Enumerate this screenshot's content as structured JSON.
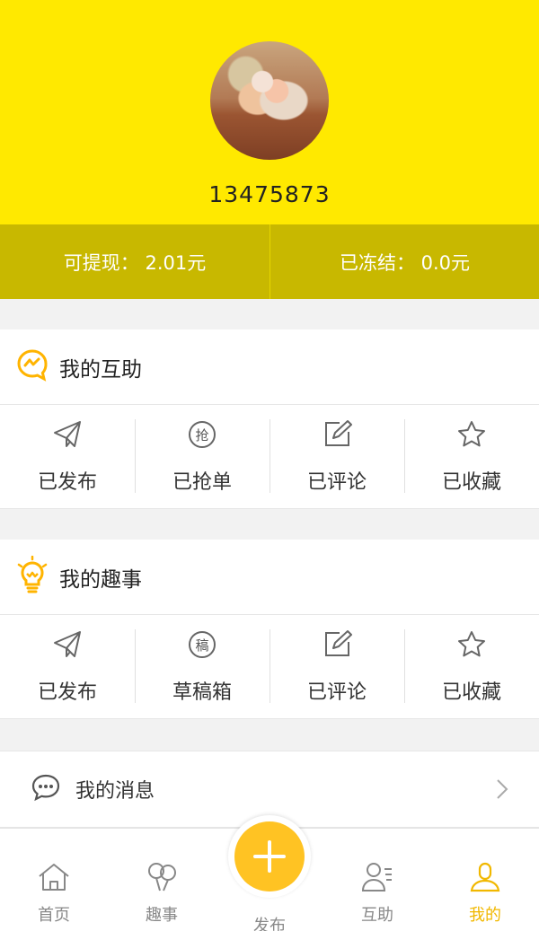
{
  "profile": {
    "phone": "13475873"
  },
  "balance": {
    "withdrawable": "可提现： 2.01元",
    "frozen": "已冻结： 0.0元"
  },
  "help_section": {
    "title": "我的互助",
    "items": [
      {
        "label": "已发布",
        "icon": "paper-plane-icon"
      },
      {
        "label": "已抢单",
        "icon": "grab-order-icon",
        "glyph": "抢"
      },
      {
        "label": "已评论",
        "icon": "edit-icon"
      },
      {
        "label": "已收藏",
        "icon": "star-icon"
      }
    ]
  },
  "fun_section": {
    "title": "我的趣事",
    "items": [
      {
        "label": "已发布",
        "icon": "paper-plane-icon"
      },
      {
        "label": "草稿箱",
        "icon": "draft-icon",
        "glyph": "稿"
      },
      {
        "label": "已评论",
        "icon": "edit-icon"
      },
      {
        "label": "已收藏",
        "icon": "star-icon"
      }
    ]
  },
  "messages": {
    "label": "我的消息"
  },
  "tabbar": {
    "tabs": [
      {
        "label": "首页",
        "icon": "home-icon"
      },
      {
        "label": "趣事",
        "icon": "balloons-icon"
      },
      {
        "label": "发布",
        "icon": "plus-icon"
      },
      {
        "label": "互助",
        "icon": "contacts-icon"
      },
      {
        "label": "我的",
        "icon": "person-icon",
        "active": true
      }
    ]
  },
  "colors": {
    "header": "#ffe900",
    "balance_bar": "#c8b800",
    "accent": "#ffc323",
    "active_tab": "#f1b800"
  }
}
